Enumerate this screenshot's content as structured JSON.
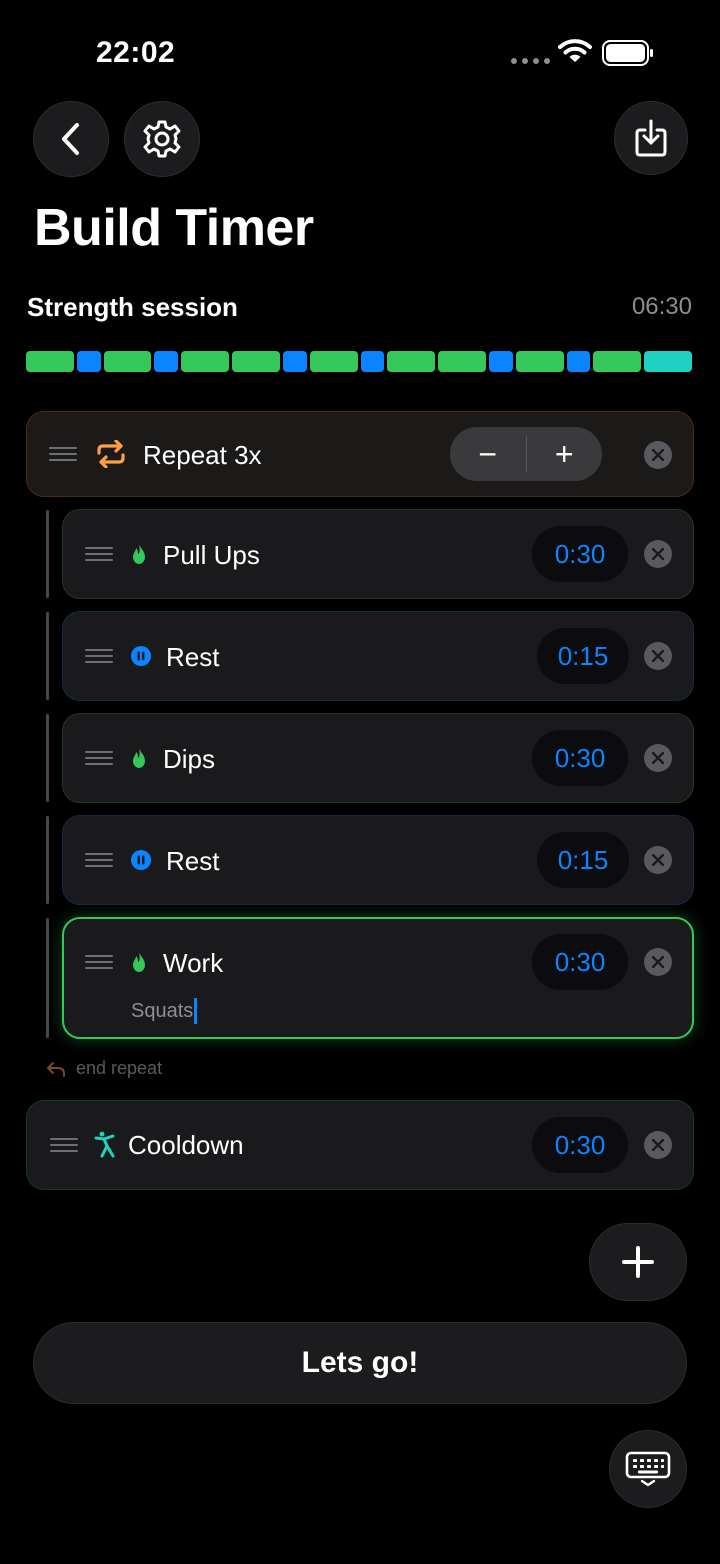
{
  "status": {
    "time": "22:02"
  },
  "header": {
    "title": "Build Timer"
  },
  "session": {
    "name": "Strength session",
    "total": "06:30"
  },
  "colors": {
    "work": "#34c759",
    "rest": "#0a84ff",
    "cooldown": "#1fd1c1",
    "repeat": "#ff9f40"
  },
  "timeline": [
    "work",
    "rest",
    "work",
    "rest",
    "work",
    "work",
    "rest",
    "work",
    "rest",
    "work",
    "work",
    "rest",
    "work",
    "rest",
    "work",
    "cooldown"
  ],
  "repeat_block": {
    "label": "Repeat 3x",
    "decrement": "−",
    "increment": "+",
    "end_label": "end repeat"
  },
  "steps": [
    {
      "label": "Pull Ups",
      "duration": "0:30",
      "kind": "work"
    },
    {
      "label": "Rest",
      "duration": "0:15",
      "kind": "rest"
    },
    {
      "label": "Dips",
      "duration": "0:30",
      "kind": "work"
    },
    {
      "label": "Rest",
      "duration": "0:15",
      "kind": "rest"
    },
    {
      "label": "Work",
      "duration": "0:30",
      "kind": "work",
      "note": "Squats"
    }
  ],
  "cooldown": {
    "label": "Cooldown",
    "duration": "0:30"
  },
  "actions": {
    "start_label": "Lets go!"
  }
}
